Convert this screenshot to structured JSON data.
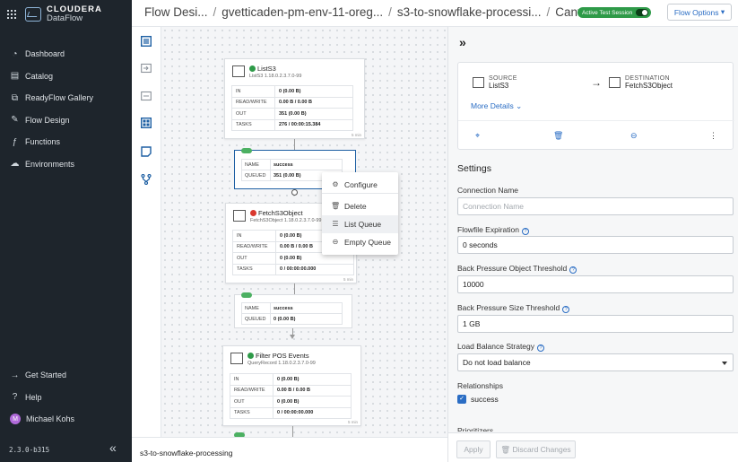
{
  "sidebar": {
    "brand_line1": "CLOUDERA",
    "brand_line2": "DataFlow",
    "items": [
      {
        "label": "Dashboard",
        "icon": "gauge-icon"
      },
      {
        "label": "Catalog",
        "icon": "book-icon"
      },
      {
        "label": "ReadyFlow Gallery",
        "icon": "gallery-icon"
      },
      {
        "label": "Flow Design",
        "icon": "pencil-icon"
      },
      {
        "label": "Functions",
        "icon": "function-icon"
      },
      {
        "label": "Environments",
        "icon": "cloud-icon"
      }
    ],
    "bottom": [
      {
        "label": "Get Started",
        "icon": "arrow-right-icon"
      },
      {
        "label": "Help",
        "icon": "help-icon"
      }
    ],
    "user": {
      "initial": "M",
      "name": "Michael Kohs"
    },
    "version": "2.3.0-b315"
  },
  "header": {
    "breadcrumbs": [
      "Flow Desi...",
      "gvetticaden-pm-env-11-oreg...",
      "s3-to-snowflake-processi...",
      "Canv..."
    ],
    "session_label": "Active Test Session",
    "flow_options_label": "Flow Options"
  },
  "canvas": {
    "processors": [
      {
        "name": "ListS3",
        "subtitle": "ListS3 1.18.0.2.3.7.0-99",
        "status": "running",
        "rows": [
          [
            "IN",
            "0 (0.00 B)"
          ],
          [
            "READ/WRITE",
            "0.00 B / 0.00 B"
          ],
          [
            "OUT",
            "351 (0.00 B)"
          ],
          [
            "TASKS",
            "276 / 00:00:15.384"
          ]
        ],
        "footer": "5 min"
      },
      {
        "name": "FetchS3Object",
        "subtitle": "FetchS3Object 1.18.0.2.3.7.0-99",
        "status": "error",
        "rows": [
          [
            "IN",
            "0 (0.00 B)"
          ],
          [
            "READ/WRITE",
            "0.00 B / 0.00 B"
          ],
          [
            "OUT",
            "0 (0.00 B)"
          ],
          [
            "TASKS",
            "0 / 00:00:00.000"
          ]
        ],
        "footer": "5 min"
      },
      {
        "name": "Filter POS Events",
        "subtitle": "QueryRecord 1.18.0.2.3.7.0-99",
        "status": "running",
        "rows": [
          [
            "IN",
            "0 (0.00 B)"
          ],
          [
            "READ/WRITE",
            "0.00 B / 0.00 B"
          ],
          [
            "OUT",
            "0 (0.00 B)"
          ],
          [
            "TASKS",
            "0 / 00:00:00.000"
          ]
        ],
        "footer": "5 min"
      }
    ],
    "connections": [
      {
        "rows": [
          [
            "NAME",
            "success"
          ],
          [
            "QUEUED",
            "351 (0.00 B)"
          ]
        ]
      },
      {
        "rows": [
          [
            "NAME",
            "success"
          ],
          [
            "QUEUED",
            "0 (0.00 B)"
          ]
        ]
      }
    ],
    "context_menu": [
      "Configure",
      "Delete",
      "List Queue",
      "Empty Queue"
    ],
    "flow_name": "s3-to-snowflake-processing"
  },
  "panel": {
    "source_label": "SOURCE",
    "source_value": "ListS3",
    "destination_label": "DESTINATION",
    "destination_value": "FetchS3Object",
    "more_details": "More Details",
    "settings_title": "Settings",
    "fields": {
      "connection_name_label": "Connection Name",
      "connection_name_placeholder": "Connection Name",
      "flowfile_expiration_label": "Flowfile Expiration",
      "flowfile_expiration_value": "0 seconds",
      "bp_object_label": "Back Pressure Object Threshold",
      "bp_object_value": "10000",
      "bp_size_label": "Back Pressure Size Threshold",
      "bp_size_value": "1 GB",
      "lb_strategy_label": "Load Balance Strategy",
      "lb_strategy_value": "Do not load balance",
      "relationships_label": "Relationships",
      "relationship_success": "success",
      "prioritizers_label": "Prioritizers"
    },
    "apply_label": "Apply",
    "discard_label": "Discard Changes"
  }
}
